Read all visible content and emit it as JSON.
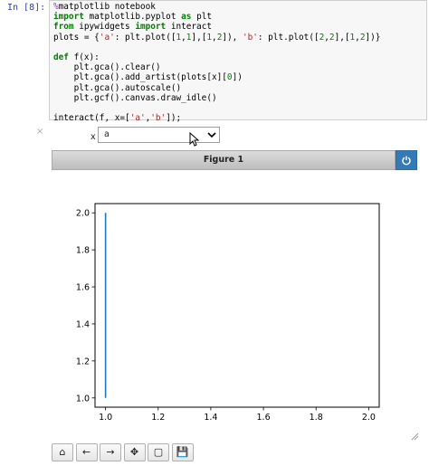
{
  "cell": {
    "prompt": "In [8]:",
    "lines": [
      [
        {
          "t": "%",
          "c": "magic"
        },
        {
          "t": "matplotlib notebook",
          "c": ""
        }
      ],
      [
        {
          "t": "import",
          "c": "kw"
        },
        {
          "t": " matplotlib.pyplot ",
          "c": ""
        },
        {
          "t": "as",
          "c": "kw"
        },
        {
          "t": " plt",
          "c": ""
        }
      ],
      [
        {
          "t": "from",
          "c": "kw"
        },
        {
          "t": " ipywidgets ",
          "c": ""
        },
        {
          "t": "import",
          "c": "kw"
        },
        {
          "t": " interact",
          "c": ""
        }
      ],
      [
        {
          "t": "plots = {",
          "c": ""
        },
        {
          "t": "'a'",
          "c": "str"
        },
        {
          "t": ": plt.plot([",
          "c": ""
        },
        {
          "t": "1",
          "c": "num"
        },
        {
          "t": ",",
          "c": ""
        },
        {
          "t": "1",
          "c": "num"
        },
        {
          "t": "],[",
          "c": ""
        },
        {
          "t": "1",
          "c": "num"
        },
        {
          "t": ",",
          "c": ""
        },
        {
          "t": "2",
          "c": "num"
        },
        {
          "t": "]), ",
          "c": ""
        },
        {
          "t": "'b'",
          "c": "str"
        },
        {
          "t": ": plt.plot([",
          "c": ""
        },
        {
          "t": "2",
          "c": "num"
        },
        {
          "t": ",",
          "c": ""
        },
        {
          "t": "2",
          "c": "num"
        },
        {
          "t": "],[",
          "c": ""
        },
        {
          "t": "1",
          "c": "num"
        },
        {
          "t": ",",
          "c": ""
        },
        {
          "t": "2",
          "c": "num"
        },
        {
          "t": "])}",
          "c": ""
        }
      ],
      [],
      [
        {
          "t": "def",
          "c": "kw"
        },
        {
          "t": " f(x):",
          "c": ""
        }
      ],
      [
        {
          "t": "    plt.gca().clear()",
          "c": ""
        }
      ],
      [
        {
          "t": "    plt.gca().add_artist(plots[x][",
          "c": ""
        },
        {
          "t": "0",
          "c": "num"
        },
        {
          "t": "])",
          "c": ""
        }
      ],
      [
        {
          "t": "    plt.gca().autoscale()",
          "c": ""
        }
      ],
      [
        {
          "t": "    plt.gcf().canvas.draw_idle()",
          "c": ""
        }
      ],
      [],
      [
        {
          "t": "interact(f, x=[",
          "c": ""
        },
        {
          "t": "'a'",
          "c": "str"
        },
        {
          "t": ",",
          "c": ""
        },
        {
          "t": "'b'",
          "c": "str"
        },
        {
          "t": "]);",
          "c": ""
        }
      ]
    ]
  },
  "widget": {
    "close_glyph": "×",
    "label": "x",
    "selected": "a",
    "chevron": "⌄"
  },
  "figure": {
    "title": "Figure 1",
    "power_glyph": "⏻"
  },
  "chart_data": {
    "type": "line",
    "series": [
      {
        "x": [
          1.0,
          1.0
        ],
        "y": [
          1.0,
          2.0
        ],
        "color": "#1f77b4"
      }
    ],
    "xlim": [
      0.96,
      2.04
    ],
    "ylim": [
      0.95,
      2.05
    ],
    "xticks": [
      1.0,
      1.2,
      1.4,
      1.6,
      1.8,
      2.0
    ],
    "yticks": [
      1.0,
      1.2,
      1.4,
      1.6,
      1.8,
      2.0
    ],
    "xtick_labels": [
      "1.0",
      "1.2",
      "1.4",
      "1.6",
      "1.8",
      "2.0"
    ],
    "ytick_labels": [
      "1.0",
      "1.2",
      "1.4",
      "1.6",
      "1.8",
      "2.0"
    ],
    "title": "",
    "xlabel": "",
    "ylabel": "",
    "grid": false
  },
  "toolbar": {
    "buttons": [
      {
        "name": "home-icon",
        "glyph": "⌂"
      },
      {
        "name": "back-arrow-icon",
        "glyph": "←"
      },
      {
        "name": "forward-arrow-icon",
        "glyph": "→"
      },
      {
        "name": "pan-move-icon",
        "glyph": "✥"
      },
      {
        "name": "zoom-rect-icon",
        "glyph": "▢"
      },
      {
        "name": "save-icon",
        "glyph": "💾"
      }
    ]
  }
}
